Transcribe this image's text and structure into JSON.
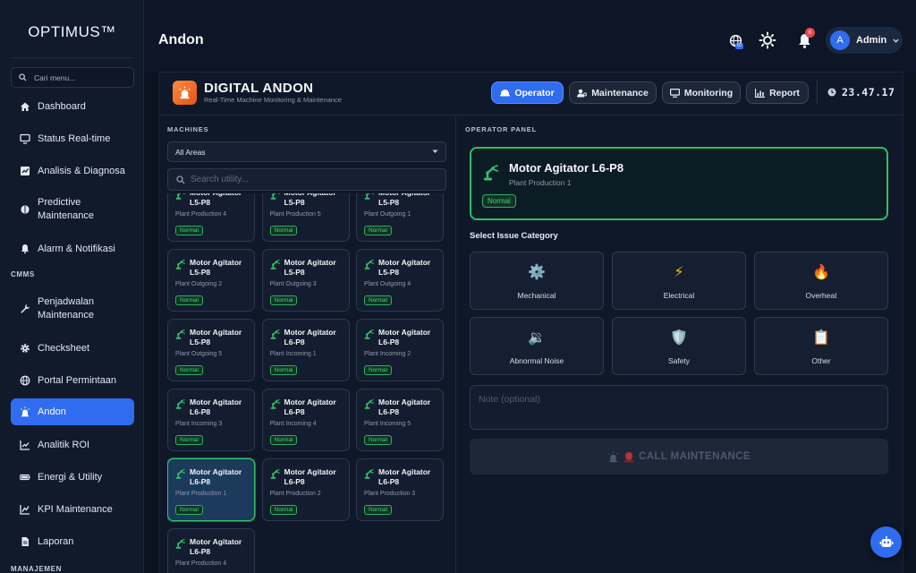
{
  "sidebar": {
    "logo": "OPTIMUS™",
    "search_placeholder": "Cari menu...",
    "items": [
      {
        "label": "Dashboard",
        "icon": "home-icon"
      },
      {
        "label": "Status Real-time",
        "icon": "monitor-icon"
      },
      {
        "label": "Analisis & Diagnosa",
        "icon": "chart-icon"
      },
      {
        "label": "Predictive Maintenance",
        "icon": "brain-icon"
      },
      {
        "label": "Alarm & Notifikasi",
        "icon": "bell-icon"
      },
      {
        "label": "Penjadwalan Maintenance",
        "icon": "wrench-icon"
      },
      {
        "label": "Checksheet",
        "icon": "gear-icon"
      },
      {
        "label": "Portal Permintaan",
        "icon": "globe-icon"
      },
      {
        "label": "Andon",
        "icon": "siren-icon",
        "active": true
      },
      {
        "label": "Analitik ROI",
        "icon": "trend-icon"
      },
      {
        "label": "Energi & Utility",
        "icon": "battery-icon"
      },
      {
        "label": "KPI Maintenance",
        "icon": "kpi-icon"
      },
      {
        "label": "Laporan",
        "icon": "document-icon"
      }
    ],
    "sections": [
      "CMMS",
      "MANAJEMEN"
    ]
  },
  "header": {
    "title": "Andon",
    "language_badge": "ID",
    "notification_count": "6",
    "user_initial": "A",
    "user_name": "Admin"
  },
  "andon": {
    "title": "DIGITAL ANDON",
    "subtitle": "Real-Time Machine Monitoring & Maintenance",
    "tabs": [
      {
        "label": "Operator",
        "active": true
      },
      {
        "label": "Maintenance"
      },
      {
        "label": "Monitoring"
      },
      {
        "label": "Report"
      }
    ],
    "clock": "23.47.17"
  },
  "machines": {
    "label": "MACHINES",
    "area_filter": "All Areas",
    "search_placeholder": "Search utility...",
    "cards": [
      {
        "name": "Motor Agitator L5-P8",
        "location": "Plant Production 4",
        "status": "Normal"
      },
      {
        "name": "Motor Agitator L5-P8",
        "location": "Plant Production 5",
        "status": "Normal"
      },
      {
        "name": "Motor Agitator L5-P8",
        "location": "Plant Outgoing 1",
        "status": "Normal"
      },
      {
        "name": "Motor Agitator L5-P8",
        "location": "Plant Outgoing 2",
        "status": "Normal"
      },
      {
        "name": "Motor Agitator L5-P8",
        "location": "Plant Outgoing 3",
        "status": "Normal"
      },
      {
        "name": "Motor Agitator L5-P8",
        "location": "Plant Outgoing 4",
        "status": "Normal"
      },
      {
        "name": "Motor Agitator L5-P8",
        "location": "Plant Outgoing 5",
        "status": "Normal"
      },
      {
        "name": "Motor Agitator L6-P8",
        "location": "Plant Incoming 1",
        "status": "Normal"
      },
      {
        "name": "Motor Agitator L6-P8",
        "location": "Plant Incoming 2",
        "status": "Normal"
      },
      {
        "name": "Motor Agitator L6-P8",
        "location": "Plant Incoming 3",
        "status": "Normal"
      },
      {
        "name": "Motor Agitator L6-P8",
        "location": "Plant Incoming 4",
        "status": "Normal"
      },
      {
        "name": "Motor Agitator L6-P8",
        "location": "Plant Incoming 5",
        "status": "Normal"
      },
      {
        "name": "Motor Agitator L6-P8",
        "location": "Plant Production 1",
        "status": "Normal",
        "selected": true
      },
      {
        "name": "Motor Agitator L6-P8",
        "location": "Plant Production 2",
        "status": "Normal"
      },
      {
        "name": "Motor Agitator L6-P8",
        "location": "Plant Production 3",
        "status": "Normal"
      },
      {
        "name": "Motor Agitator L6-P8",
        "location": "Plant Production 4",
        "status": "Normal"
      }
    ]
  },
  "operator": {
    "label": "OPERATOR PANEL",
    "selected": {
      "name": "Motor Agitator L6-P8",
      "location": "Plant Production 1",
      "status": "Normal"
    },
    "issue_label": "Select Issue Category",
    "issues": [
      {
        "label": "Mechanical",
        "icon": "gear-icon",
        "glyph": "⚙️"
      },
      {
        "label": "Electrical",
        "icon": "lightning-icon",
        "glyph": "⚡"
      },
      {
        "label": "Overheat",
        "icon": "fire-icon",
        "glyph": "🔥"
      },
      {
        "label": "Abnormal Noise",
        "icon": "speaker-icon",
        "glyph": "🔉"
      },
      {
        "label": "Safety",
        "icon": "shield-icon",
        "glyph": "🛡️"
      },
      {
        "label": "Other",
        "icon": "clipboard-icon",
        "glyph": "📋"
      }
    ],
    "note_placeholder": "Note (optional)",
    "call_label": "CALL MAINTENANCE"
  },
  "colors": {
    "accent": "#2f6cf0",
    "status_normal": "#3fd47c",
    "danger": "#e5484d",
    "brand_orange": "#ff8a3d"
  }
}
